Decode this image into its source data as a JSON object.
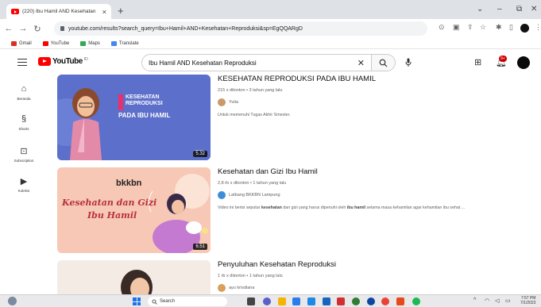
{
  "browser": {
    "tab_title": "(220) Ibu Hamil AND Kesehatan",
    "new_tab": "+",
    "url": "youtube.com/results?search_query=Ibu+Hamil+AND+Kesehatan+Reproduksi&sp=EgQQARgD",
    "bookmarks": [
      {
        "label": "Gmail",
        "color": "#d93025"
      },
      {
        "label": "YouTube",
        "color": "#ff0000"
      },
      {
        "label": "Maps",
        "color": "#34a853"
      },
      {
        "label": "Translate",
        "color": "#4285f4"
      }
    ]
  },
  "youtube": {
    "logo_text": "YouTube",
    "logo_sup": "ID",
    "search_value": "Ibu Hamil AND Kesehatan Reproduksi",
    "notif_count": "9+",
    "sidebar": [
      {
        "label": "Beranda",
        "icon": "home-icon"
      },
      {
        "label": "Shorts",
        "icon": "shorts-icon"
      },
      {
        "label": "Subscription",
        "icon": "subscriptions-icon"
      },
      {
        "label": "Koleksi",
        "icon": "library-icon"
      }
    ],
    "results": [
      {
        "title": "KESEHATAN REPRODUKSI PADA IBU HAMIL",
        "meta": "215 x ditonton • 3 tahun yang lalu",
        "channel": "Yulia",
        "description": "Untuk memenuhi Tugas Akhir Smester.",
        "duration": "5.32",
        "thumb_text_1": "KESEHATAN REPRODUKSI",
        "thumb_text_2": "PADA IBU HAMIL"
      },
      {
        "title": "Kesehatan dan Gizi Ibu Hamil",
        "meta": "2,8 rb x ditonton • 1 tahun yang lalu",
        "channel": "Latbang BKKBN Lampung",
        "description_pre": "Video ini berisi seputar ",
        "description_b1": "kesehatan",
        "description_mid": " dan gizi yang harus dipenuhi oleh ",
        "description_b2": "ibu hamil",
        "description_post": " selama masa kehamilan agar kehamilan ibu sehat ...",
        "duration": "6.51",
        "thumb_brand": "bkkbn",
        "thumb_script_1": "Kesehatan dan Gizi",
        "thumb_script_2": "Ibu Hamil"
      },
      {
        "title": "Penyuluhan Kesehatan Reproduksi",
        "meta": "1 rb x ditonton • 1 tahun yang lalu",
        "channel": "ayu krisdiana"
      }
    ]
  },
  "taskbar": {
    "search_label": "Search",
    "time": "7:57 PM",
    "date": "7/1/2023"
  }
}
